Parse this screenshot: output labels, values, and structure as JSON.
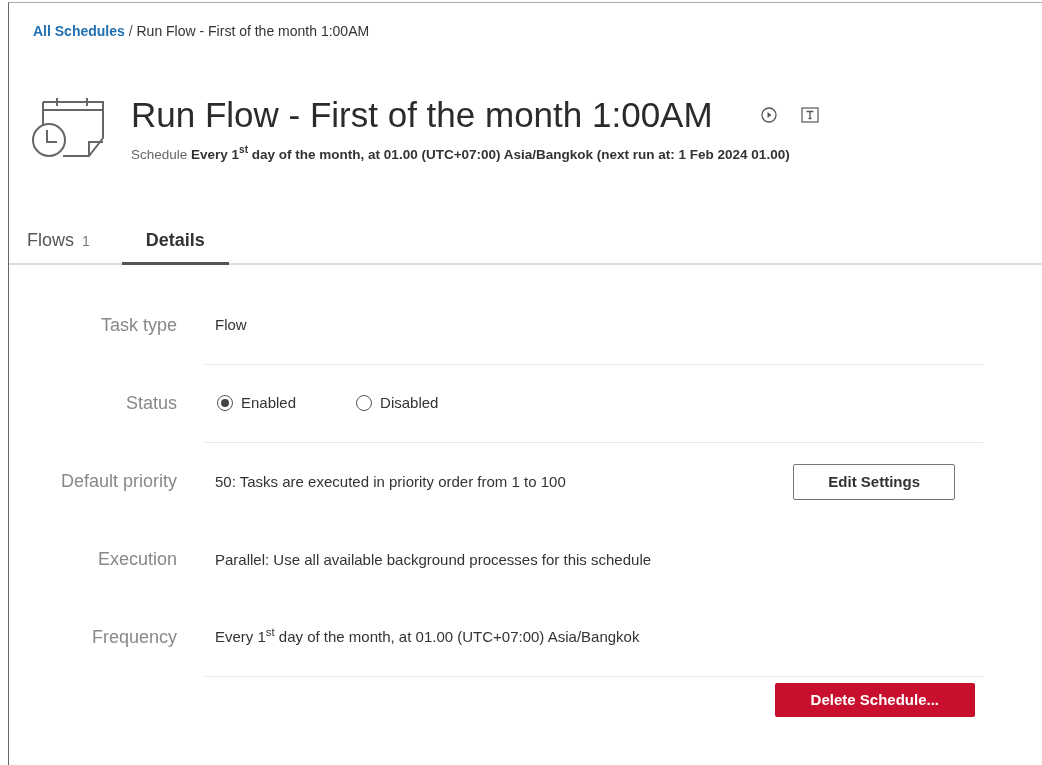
{
  "breadcrumb": {
    "link": "All Schedules",
    "separator": "/",
    "current": "Run Flow - First of the month 1:00AM"
  },
  "header": {
    "title": "Run Flow - First of the month 1:00AM",
    "schedule_label": "Schedule",
    "schedule_value": "Every 1$^{st}$ day of the month, at 01.00 (UTC+07:00) Asia/Bangkok  (next run at: 1 Feb 2024 01.00)"
  },
  "tabs": [
    {
      "label": "Flows",
      "count": "1",
      "selected": false
    },
    {
      "label": "Details",
      "selected": true
    }
  ],
  "details": [
    {
      "kind": "text",
      "label": "Task type",
      "value": "Flow",
      "divider": true
    },
    {
      "kind": "radio",
      "label": "Status",
      "options": [
        {
          "label": "Enabled",
          "selected": true
        },
        {
          "label": "Disabled",
          "selected": false
        }
      ],
      "divider": true
    },
    {
      "kind": "text",
      "label": "Default priority",
      "value": "50: Tasks are executed in priority order from 1 to 100",
      "button": "Edit Settings",
      "divider": false
    },
    {
      "kind": "text",
      "label": "Execution",
      "value": "Parallel: Use all available background processes for this schedule",
      "divider": false
    },
    {
      "kind": "text",
      "label": "Frequency",
      "value": "Every 1$^{st}$ day of the month, at 01.00 (UTC+07:00) Asia/Bangkok",
      "divider": true
    }
  ],
  "delete_button": "Delete Schedule..."
}
